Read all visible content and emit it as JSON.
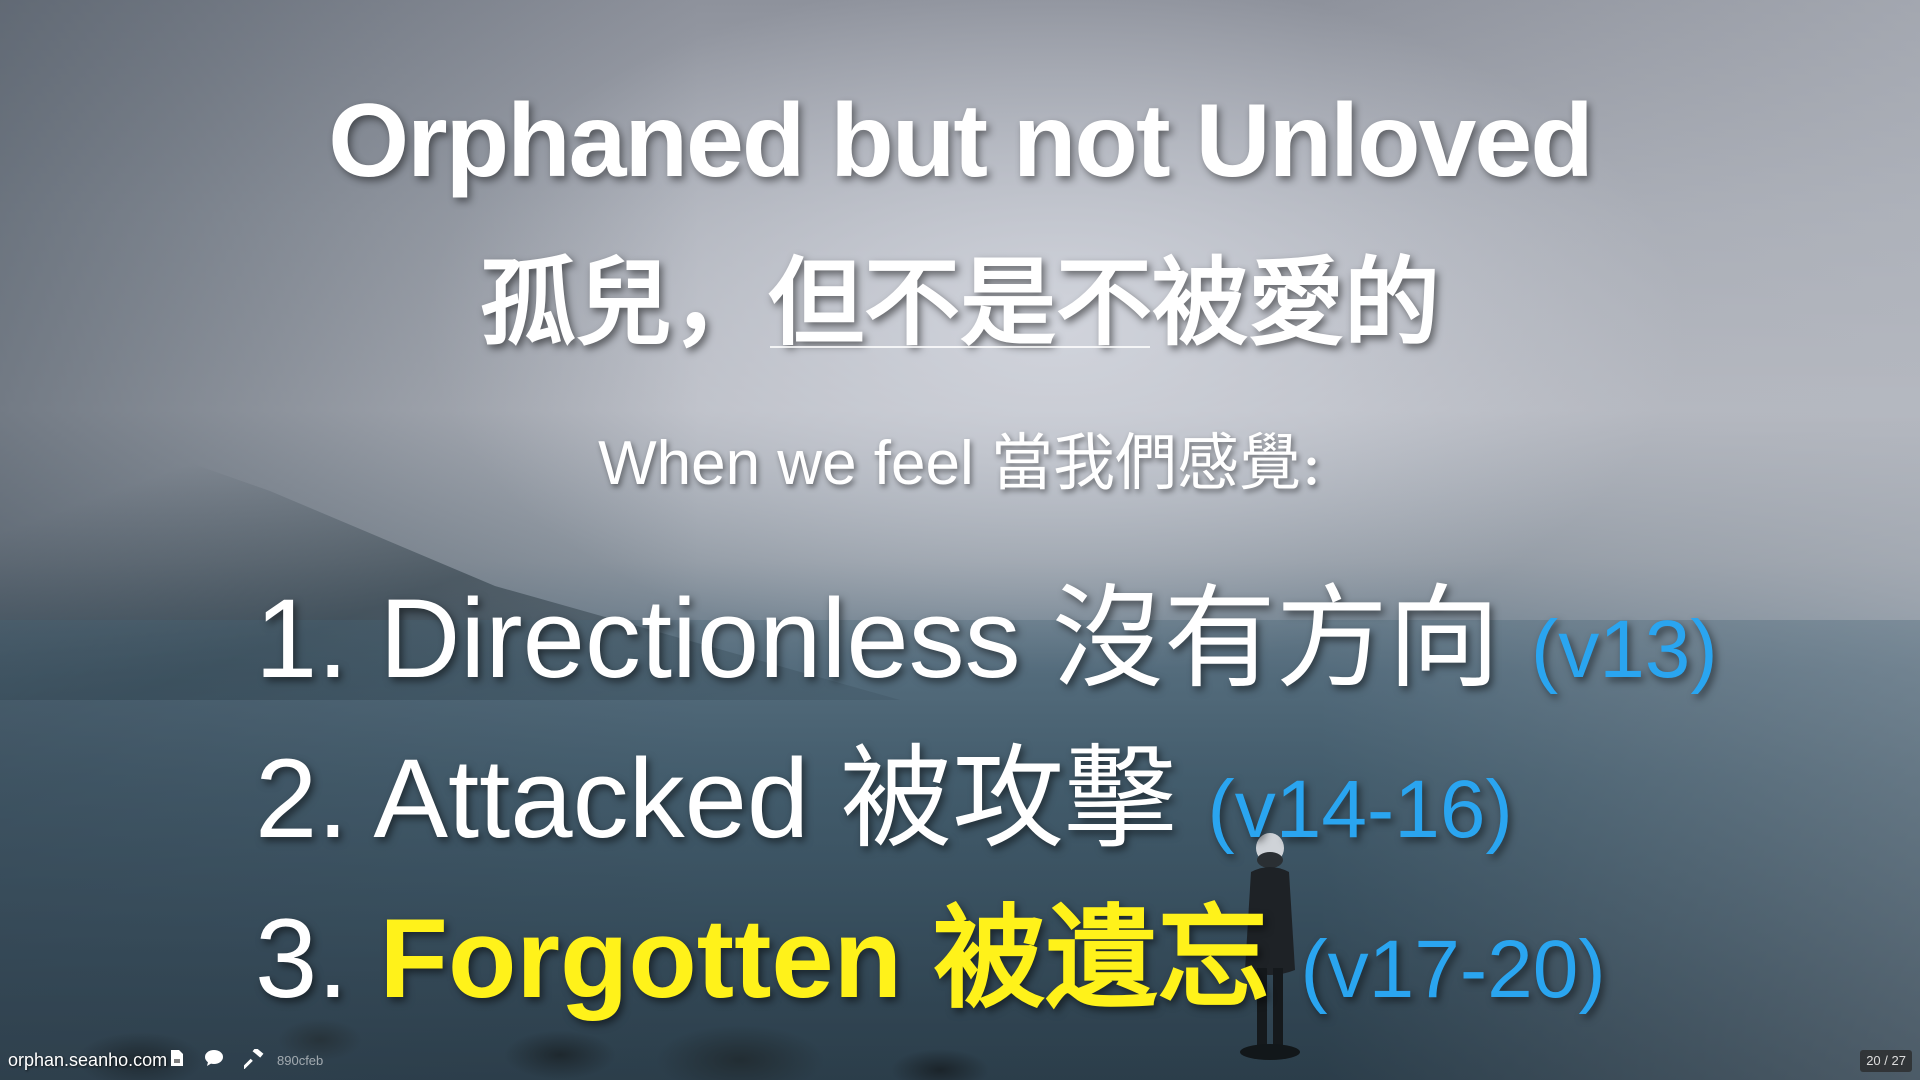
{
  "slide": {
    "title_en": "Orphaned but not Unloved",
    "title_zh": "孤兒，但不是不被愛的",
    "subtitle_en": "When we feel",
    "subtitle_zh": "當我們感覺:",
    "items": [
      {
        "number": "1.",
        "text": "Directionless",
        "zh": "沒有方向",
        "ref": "(v13)",
        "highlighted": false
      },
      {
        "number": "2.",
        "text": "Attacked",
        "zh": "被攻擊",
        "ref": "(v14-16)",
        "highlighted": false
      },
      {
        "number": "3.",
        "text": "Forgotten",
        "zh": "被遺忘",
        "ref": "(v17-20)",
        "highlighted": true
      }
    ]
  },
  "footer": {
    "site": "orphan.seanho.com",
    "icons": [
      "pdf-icon",
      "comment-icon",
      "hammer-icon"
    ],
    "commit": "890cfeb",
    "page_current": "20",
    "page_sep": "/",
    "page_total": "27"
  },
  "colors": {
    "ref": "#2aa5f0",
    "highlight": "#fff21a",
    "text": "#ffffff"
  }
}
